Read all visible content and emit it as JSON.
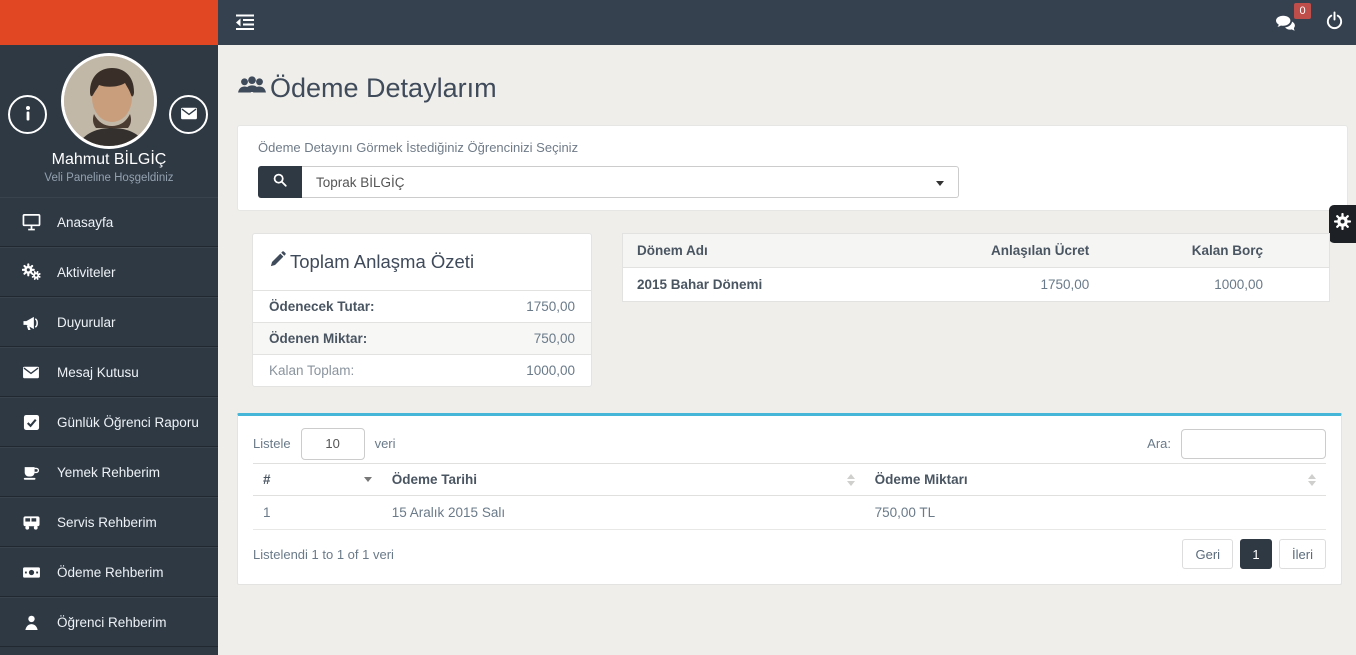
{
  "topbar": {
    "messages_badge": "0"
  },
  "sidebar": {
    "profile": {
      "name": "Mahmut BİLGİÇ",
      "subtitle": "Veli Paneline Hoşgeldiniz"
    },
    "items": [
      {
        "label": "Anasayfa",
        "icon": "monitor-icon"
      },
      {
        "label": "Aktiviteler",
        "icon": "gears-icon"
      },
      {
        "label": "Duyurular",
        "icon": "bullhorn-icon"
      },
      {
        "label": "Mesaj Kutusu",
        "icon": "envelope-icon"
      },
      {
        "label": "Günlük Öğrenci Raporu",
        "icon": "check-square-icon"
      },
      {
        "label": "Yemek Rehberim",
        "icon": "food-icon"
      },
      {
        "label": "Servis Rehberim",
        "icon": "bus-icon"
      },
      {
        "label": "Ödeme Rehberim",
        "icon": "money-icon"
      },
      {
        "label": "Öğrenci Rehberim",
        "icon": "user-icon"
      }
    ]
  },
  "main": {
    "page_title": "Ödeme Detaylarım",
    "student_select": {
      "label": "Ödeme Detayını Görmek İstediğiniz Öğrencinizi Seçiniz",
      "value": "Toprak BİLGİÇ"
    },
    "summary": {
      "title": "Toplam Anlaşma Özeti",
      "rows": [
        {
          "label": "Ödenecek Tutar:",
          "value": "1750,00"
        },
        {
          "label": "Ödenen Miktar:",
          "value": "750,00"
        },
        {
          "label": "Kalan Toplam:",
          "value": "1000,00"
        }
      ]
    },
    "period_table": {
      "headers": [
        "Dönem Adı",
        "Anlaşılan Ücret",
        "Kalan Borç"
      ],
      "rows": [
        [
          "2015 Bahar Dönemi",
          "1750,00",
          "1000,00"
        ]
      ]
    },
    "payments": {
      "length_prefix": "Listele",
      "length_value": "10",
      "length_suffix": "veri",
      "search_label": "Ara:",
      "headers": [
        "#",
        "Ödeme Tarihi",
        "Ödeme Miktarı"
      ],
      "rows": [
        [
          "1",
          "15 Aralık 2015 Salı",
          "750,00 TL"
        ]
      ],
      "info": "Listelendi 1 to 1 of 1 veri",
      "pager": {
        "prev": "Geri",
        "current": "1",
        "next": "İleri"
      }
    }
  },
  "colors": {
    "brand_red": "#e24723",
    "topbar": "#364150",
    "sidebar": "#2f3944",
    "accent_cyan": "#45b6d8",
    "badge_red": "#bf4d4a",
    "pager_active": "#2f3944"
  }
}
